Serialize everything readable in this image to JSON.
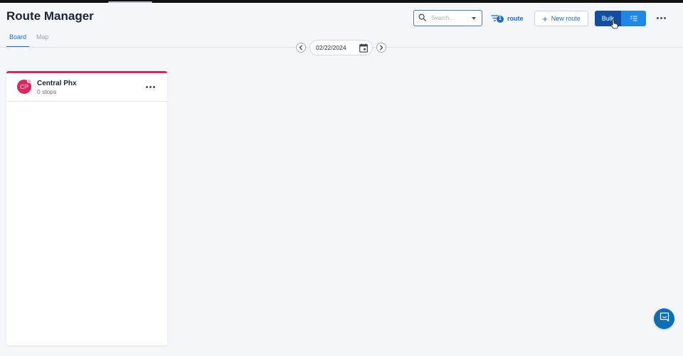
{
  "header": {
    "title": "Route Manager"
  },
  "tabs": [
    {
      "label": "Board",
      "active": true
    },
    {
      "label": "Map",
      "active": false
    }
  ],
  "toolbar": {
    "search_placeholder": "Search...",
    "filter_count": "1",
    "filter_label": "route",
    "new_route_label": "New route",
    "bulk_label": "Bulk"
  },
  "date_nav": {
    "date": "02/22/2024"
  },
  "routes": [
    {
      "initials": "CP",
      "name": "Central Phx",
      "stops": "0 stops",
      "color": "#e0245e"
    }
  ],
  "colors": {
    "accent": "#1a6ec2",
    "bulk_primary": "#0f4fa3",
    "bulk_secondary": "#1e88e5",
    "route_color": "#e0245e",
    "chat_button": "#0b6fb8"
  },
  "icons": {
    "search": "search-icon",
    "filter": "filter-icon",
    "add": "plus-icon",
    "bulk_view": "list-check-icon",
    "more": "more-horizontal-icon",
    "prev": "chevron-left-icon",
    "next": "chevron-right-icon",
    "calendar": "calendar-icon",
    "chat": "chat-icon"
  }
}
